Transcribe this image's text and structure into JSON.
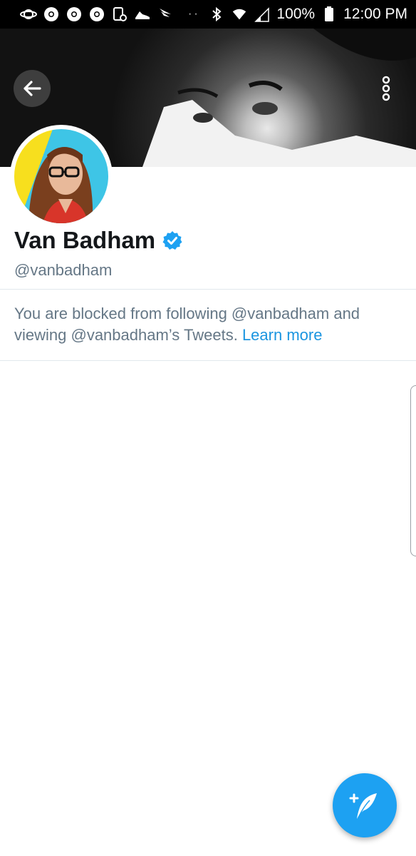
{
  "status_bar": {
    "left_icons": [
      "saturn-icon",
      "chrome-icon",
      "chrome-icon",
      "chrome-icon",
      "screenshot-icon",
      "sneaker-icon",
      "sprint-icon"
    ],
    "right_icons": [
      "bluetooth-icon",
      "wifi-icon",
      "signal-icon",
      "battery-icon"
    ],
    "battery": "100%",
    "time": "12:00 PM"
  },
  "header": {
    "back_icon": "arrow-left-icon",
    "more_icon": "vertical-dots-icon"
  },
  "profile": {
    "name": "Van Badham",
    "verified": true,
    "handle": "@vanbadham"
  },
  "blocked_notice": {
    "text": "You are blocked from following @vanbadham and viewing @vanbadham’s Tweets.",
    "link": "Learn more"
  },
  "fab": {
    "icon": "compose-tweet-icon"
  },
  "colors": {
    "accent": "#1da1f2",
    "link": "#1b95e0",
    "secondary_text": "#657786",
    "primary_text": "#14171a",
    "divider": "#e1e8ed"
  }
}
